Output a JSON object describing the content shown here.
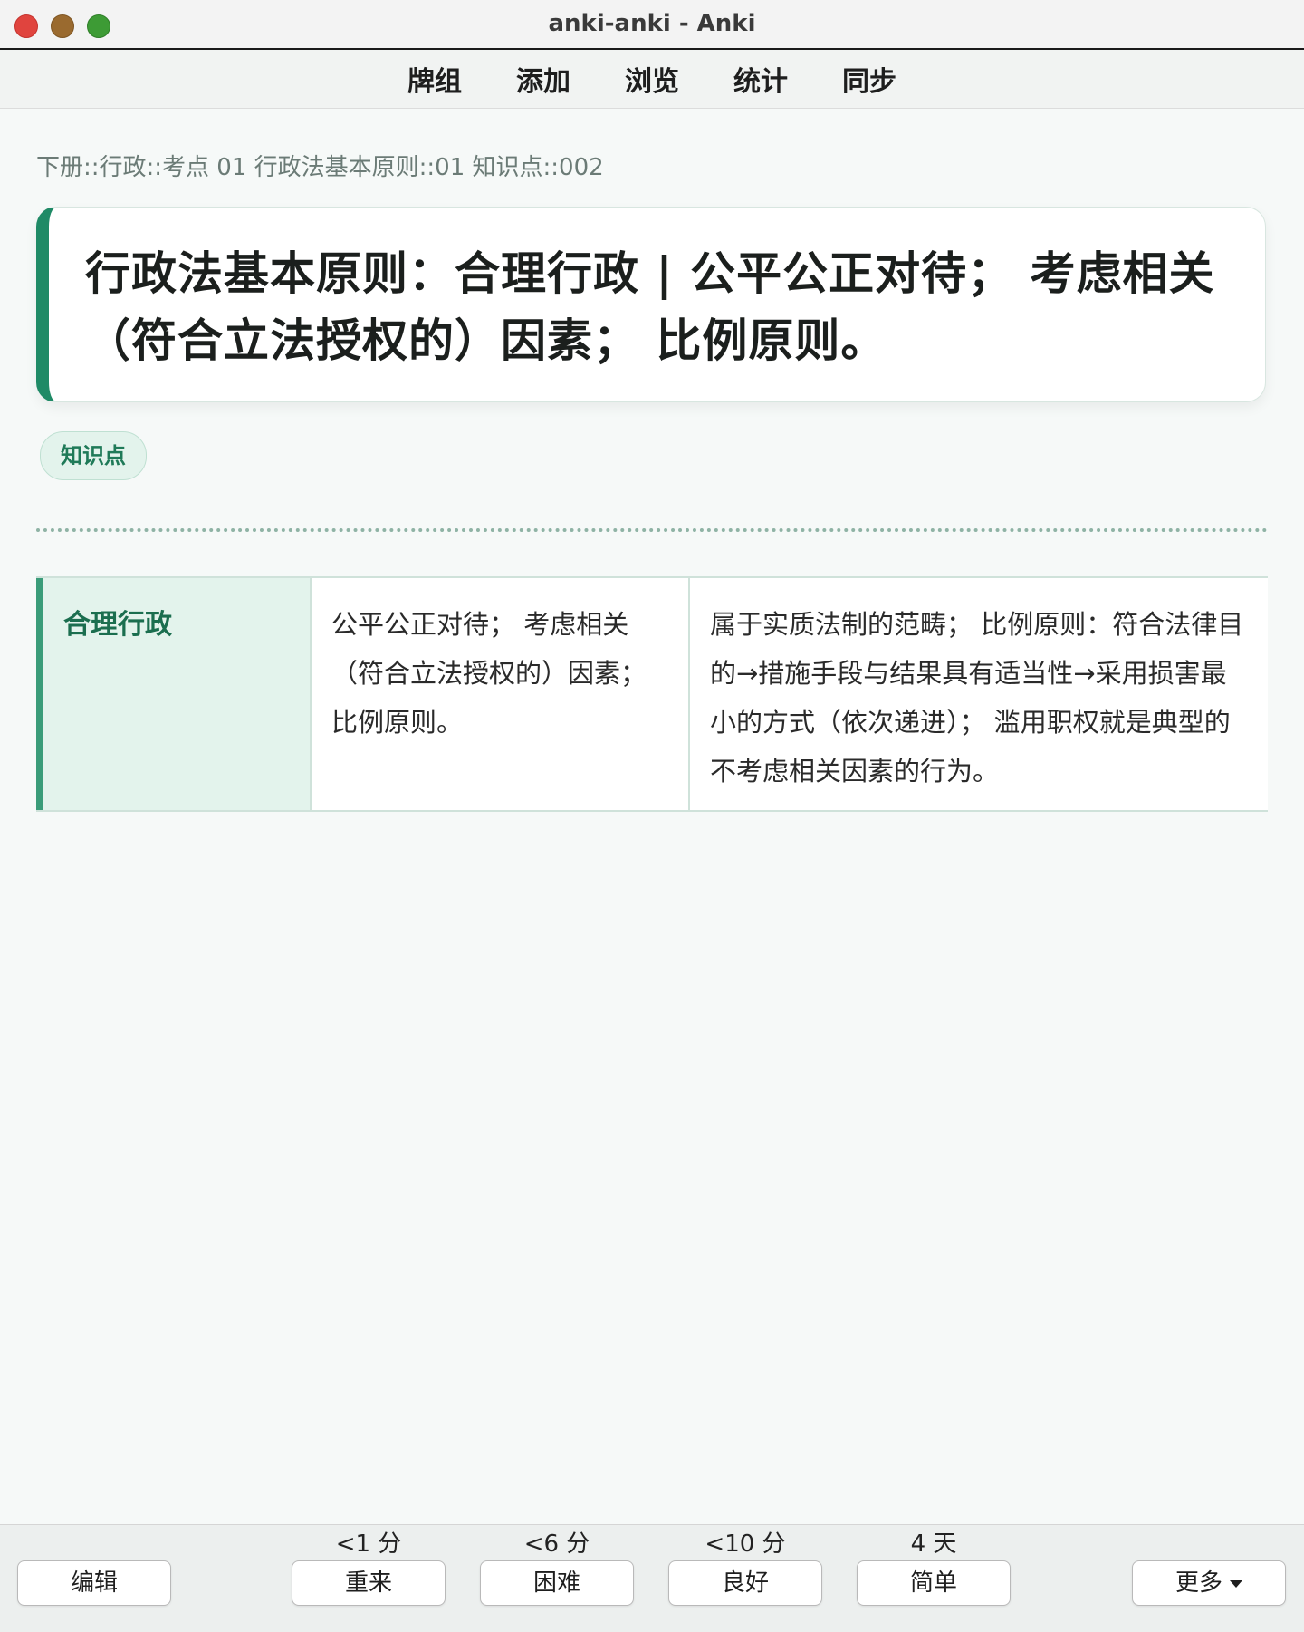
{
  "window": {
    "title": "anki-anki - Anki"
  },
  "toolbar": {
    "items": [
      "牌组",
      "添加",
      "浏览",
      "统计",
      "同步"
    ]
  },
  "card": {
    "deck_path": "下册::行政::考点 01 行政法基本原则::01 知识点::002",
    "question": "行政法基本原则：合理行政 | 公平公正对待； 考虑相关（符合立法授权的）因素； 比例原则。",
    "tag": "知识点",
    "answer": {
      "key": "合理行政",
      "mid": "公平公正对待； 考虑相关（符合立法授权的）因素； 比例原则。",
      "right": "属于实质法制的范畴； 比例原则：符合法律目的→措施手段与结果具有适当性→采用损害最小的方式（依次递进）； 滥用职权就是典型的不考虑相关因素的行为。"
    },
    "accent_color": "#1f8a66"
  },
  "bottom": {
    "edit_label": "编辑",
    "more_label": "更多",
    "answers": [
      {
        "interval": "<1 分",
        "label": "重来"
      },
      {
        "interval": "<6 分",
        "label": "困难"
      },
      {
        "interval": "<10 分",
        "label": "良好"
      },
      {
        "interval": "4 天",
        "label": "简单"
      }
    ]
  }
}
